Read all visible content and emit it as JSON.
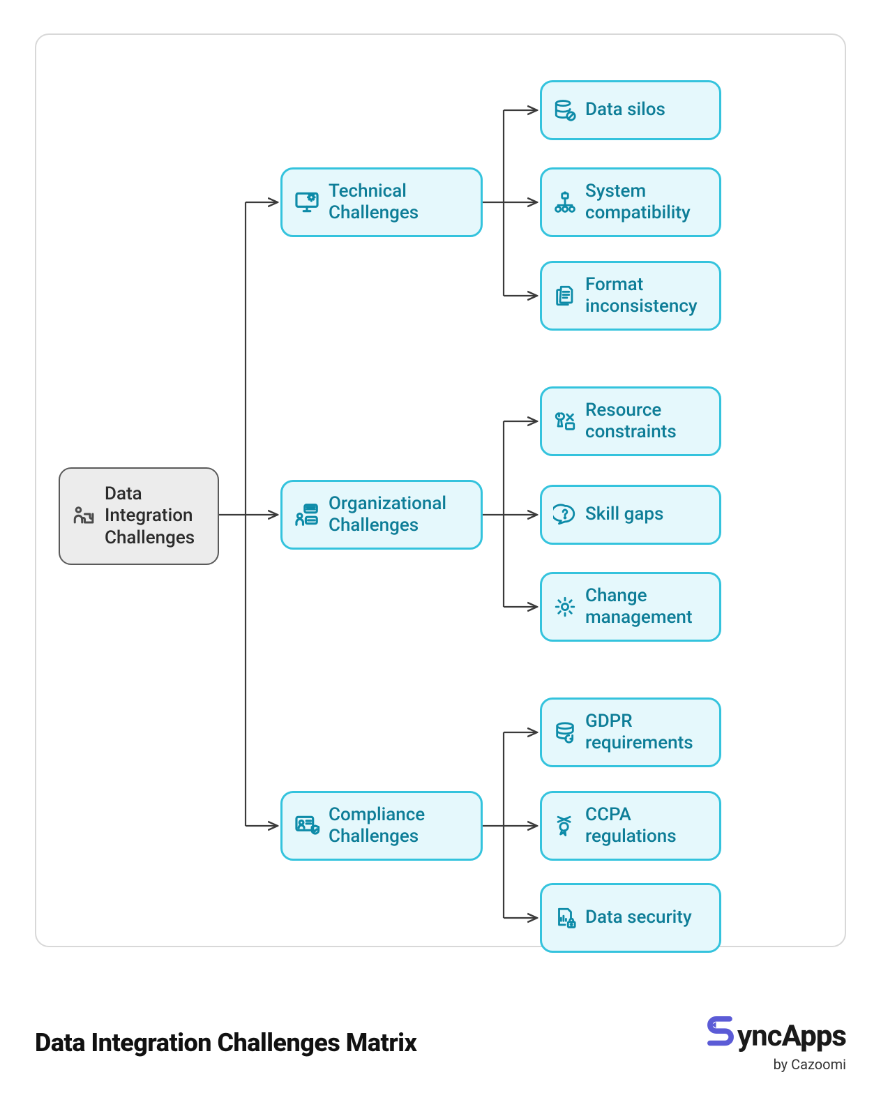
{
  "diagram": {
    "root": {
      "label": "Data Integration Challenges"
    },
    "cats": [
      {
        "label": "Technical Challenges"
      },
      {
        "label": "Organizational Challenges"
      },
      {
        "label": "Compliance Challenges"
      }
    ],
    "leaves": [
      {
        "label": "Data silos"
      },
      {
        "label": "System compatibility"
      },
      {
        "label": "Format inconsistency"
      },
      {
        "label": "Resource constraints"
      },
      {
        "label": "Skill gaps"
      },
      {
        "label": "Change management"
      },
      {
        "label": "GDPR requirements"
      },
      {
        "label": "CCPA regulations"
      },
      {
        "label": "Data security"
      }
    ]
  },
  "footer": {
    "title": "Data Integration Challenges Matrix",
    "logo_sync": "ync",
    "logo_apps": "Apps",
    "logo_by": "by Cazoomi"
  },
  "colors": {
    "line": "#3a3a3a",
    "cat_border": "#34c3dd",
    "cat_fill": "#e5f8fc",
    "cat_text": "#0d7d97",
    "root_border": "#5a5a5a",
    "root_fill": "#ececec"
  }
}
